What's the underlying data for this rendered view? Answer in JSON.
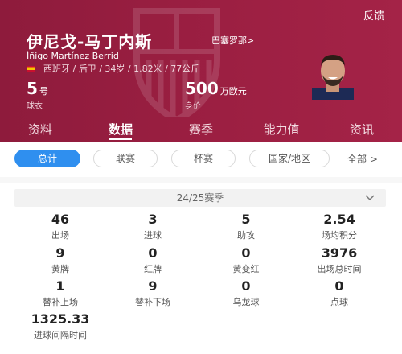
{
  "header": {
    "feedback_label": "反馈",
    "player_name": "伊尼戈-马丁内斯",
    "club_link": "巴塞罗那>",
    "player_name_en": "Íñigo Martínez Berrid",
    "info": "西班牙 / 后卫 / 34岁 / 1.82米 / 77公斤",
    "jersey_number": "5",
    "jersey_unit": "号",
    "jersey_label": "球衣",
    "market_value": "500",
    "market_value_unit": "万欧元",
    "market_value_label": "身价",
    "accent_color": "#9c1f42"
  },
  "tabs": [
    {
      "label": "资料",
      "active": false
    },
    {
      "label": "数据",
      "active": true
    },
    {
      "label": "赛季",
      "active": false
    },
    {
      "label": "能力值",
      "active": false
    },
    {
      "label": "资讯",
      "active": false
    }
  ],
  "filters": {
    "items": [
      {
        "label": "总计",
        "active": true
      },
      {
        "label": "联赛",
        "active": false
      },
      {
        "label": "杯赛",
        "active": false
      },
      {
        "label": "国家/地区",
        "active": false
      }
    ],
    "more_label": "全部 >",
    "active_color": "#2f8fef"
  },
  "season": {
    "selected": "24/25赛季",
    "icon": "chevron-down-icon"
  },
  "stats": [
    {
      "value": "46",
      "label": "出场"
    },
    {
      "value": "3",
      "label": "进球"
    },
    {
      "value": "5",
      "label": "助攻"
    },
    {
      "value": "2.54",
      "label": "场均积分"
    },
    {
      "value": "9",
      "label": "黄牌"
    },
    {
      "value": "0",
      "label": "红牌"
    },
    {
      "value": "0",
      "label": "黄变红"
    },
    {
      "value": "3976",
      "label": "出场总时间"
    },
    {
      "value": "1",
      "label": "替补上场"
    },
    {
      "value": "9",
      "label": "替补下场"
    },
    {
      "value": "0",
      "label": "乌龙球"
    },
    {
      "value": "0",
      "label": "点球"
    },
    {
      "value": "1325.33",
      "label": "进球间隔时间"
    }
  ]
}
